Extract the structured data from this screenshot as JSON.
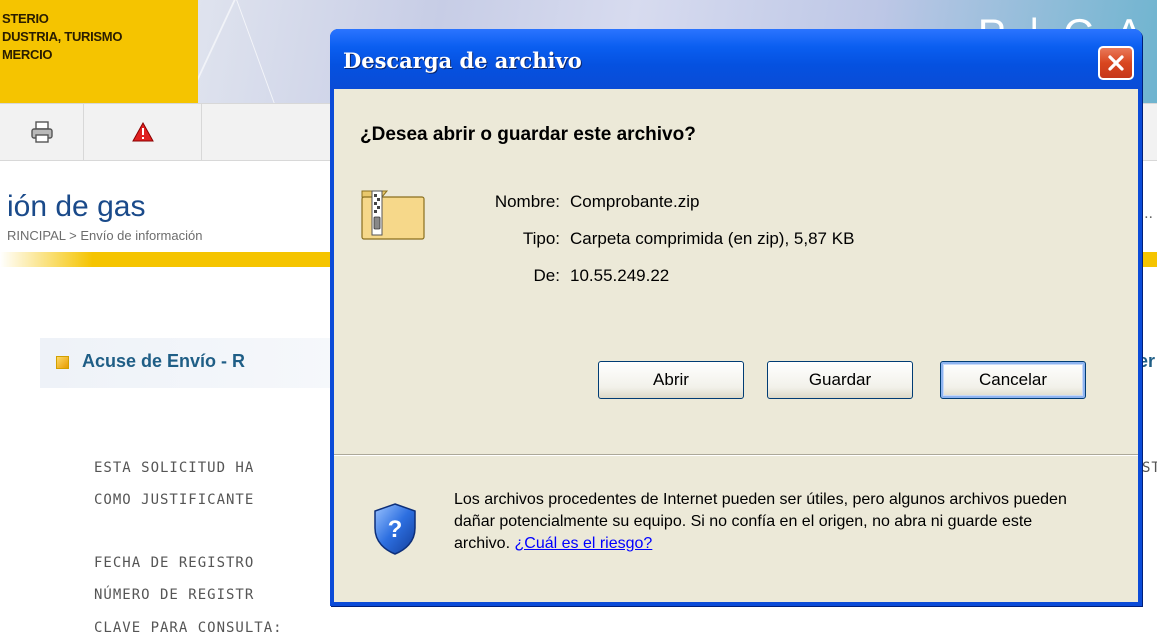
{
  "header": {
    "ministry_lines": [
      "STERIO",
      "DUSTRIA, TURISMO",
      "MERCIO"
    ],
    "banner_text": "P | C A"
  },
  "toolbar": {
    "icons": [
      "printer-icon",
      "warning-icon"
    ]
  },
  "page": {
    "title": "ión de gas",
    "breadcrumb": "RINCIPAL > Envío de información",
    "overflow": "..",
    "section_title": "Acuse de Envío - R",
    "section_tail": "er",
    "text_lines": [
      "ESTA SOLICITUD HA",
      "COMO JUSTIFICANTE",
      "FECHA DE REGISTRO",
      "NÚMERO DE REGISTR",
      "CLAVE PARA CONSULTA:"
    ],
    "text_right": "ST"
  },
  "dialog": {
    "title": "Descarga de archivo",
    "question": "¿Desea abrir o guardar este archivo?",
    "name_label": "Nombre:",
    "name_value": "Comprobante.zip",
    "type_label": "Tipo:",
    "type_value": "Carpeta comprimida (en zip), 5,87 KB",
    "from_label": "De:",
    "from_value": "10.55.249.22",
    "buttons": {
      "open": "Abrir",
      "save": "Guardar",
      "cancel": "Cancelar"
    },
    "warning_text": "Los archivos procedentes de Internet pueden ser útiles, pero algunos archivos pueden dañar potencialmente su equipo. Si no confía en el origen, no abra ni guarde este archivo.",
    "risk_link": "¿Cuál es el riesgo?"
  },
  "colors": {
    "titlebar": "#0a5ef0",
    "dialog_body": "#ece9d8",
    "header_yellow": "#f5c400",
    "close_red": "#d9461f"
  }
}
